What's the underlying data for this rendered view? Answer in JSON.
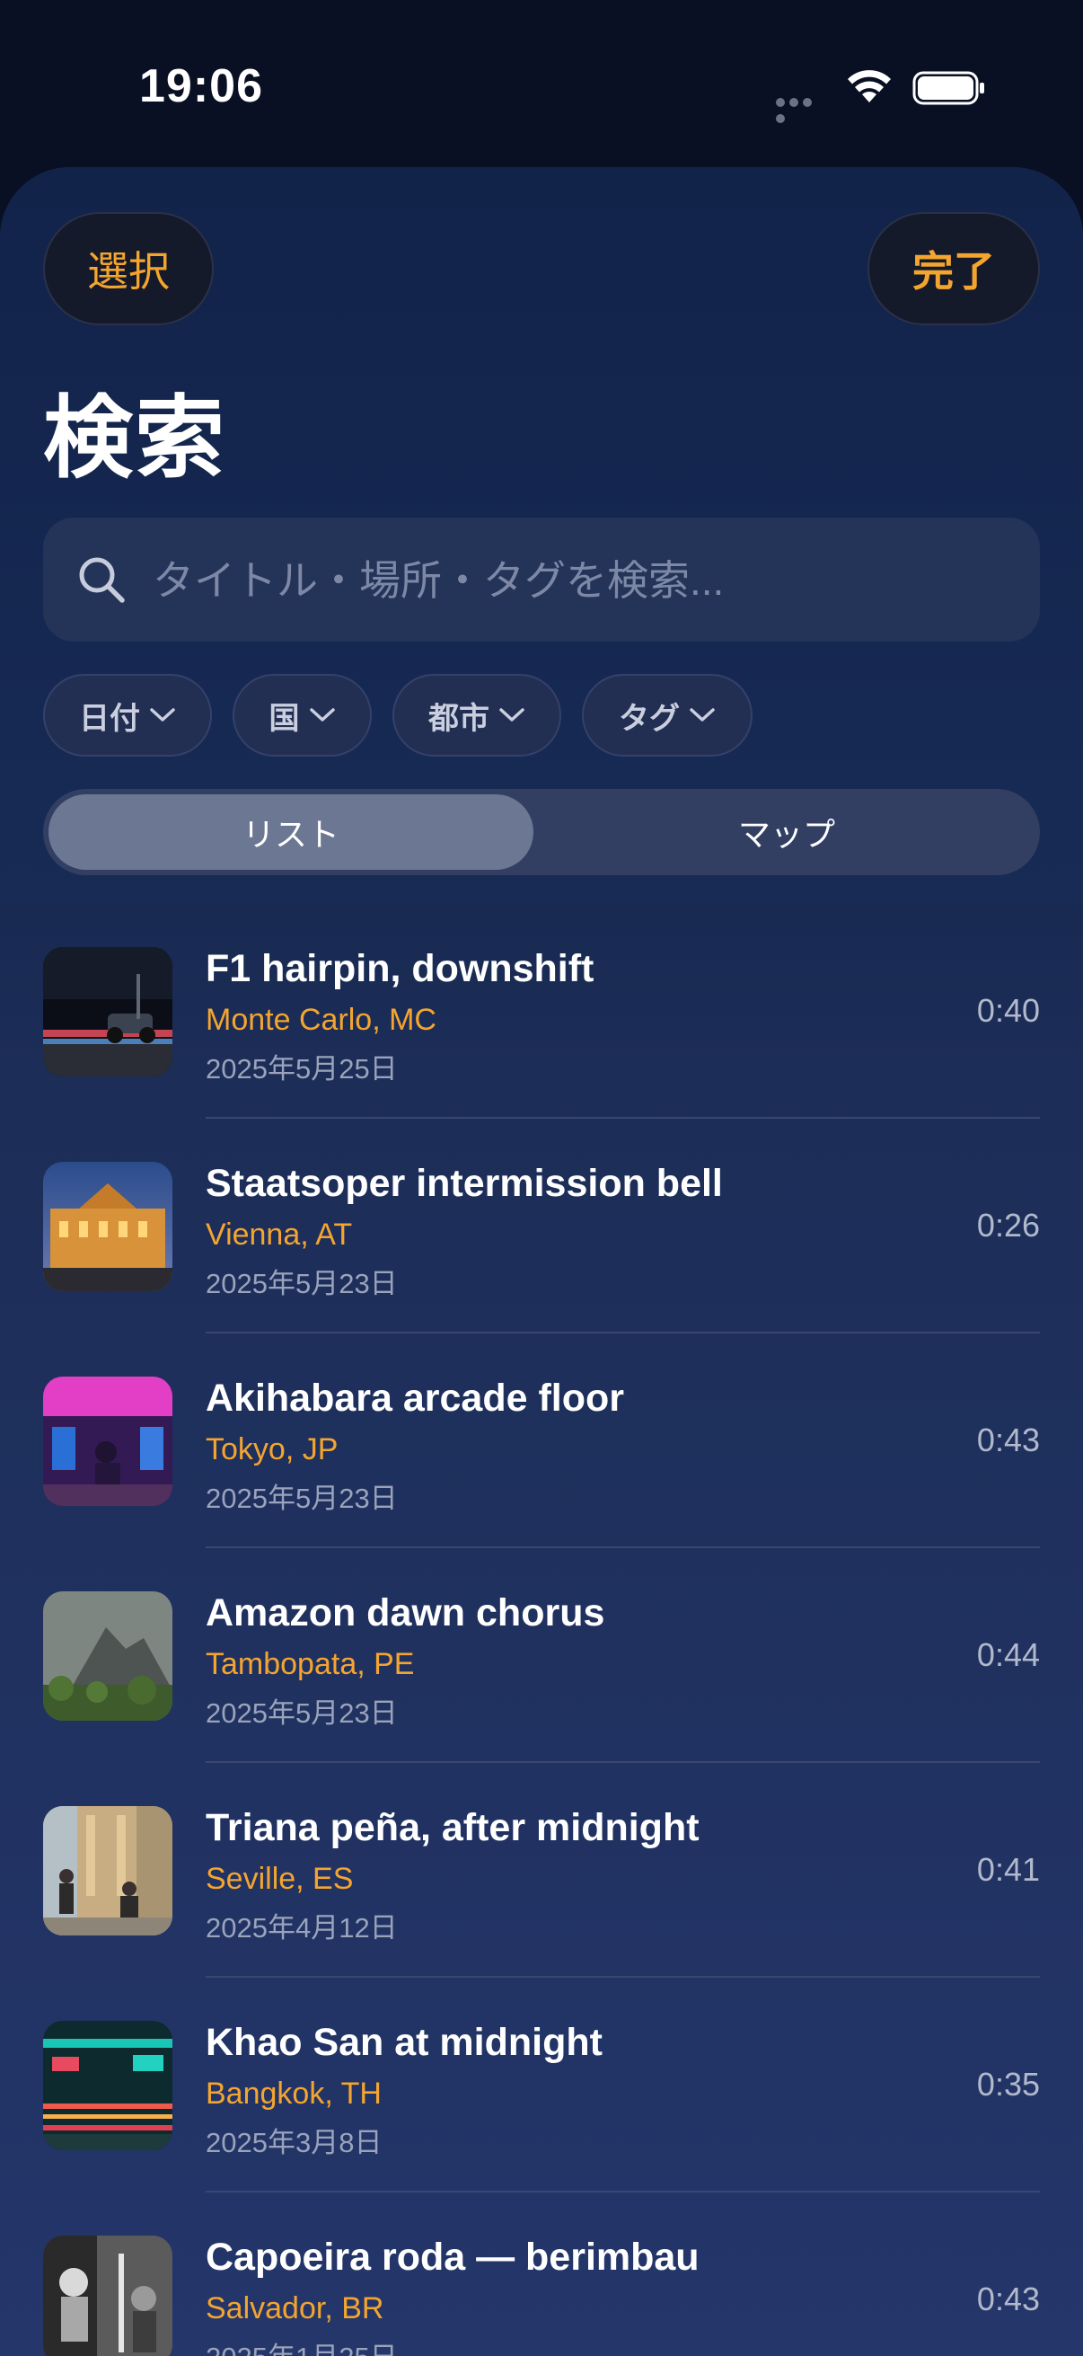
{
  "status_bar": {
    "time": "19:06"
  },
  "header": {
    "select_label": "選択",
    "done_label": "完了",
    "title": "検索"
  },
  "search": {
    "placeholder": "タイトル・場所・タグを検索..."
  },
  "filters": [
    {
      "label": "日付"
    },
    {
      "label": "国"
    },
    {
      "label": "都市"
    },
    {
      "label": "タグ"
    }
  ],
  "segment": {
    "list_label": "リスト",
    "map_label": "マップ",
    "selected": "リスト"
  },
  "recordings": [
    {
      "title": "F1 hairpin, downshift",
      "location": "Monte Carlo, MC",
      "date": "2025年5月25日",
      "duration": "0:40"
    },
    {
      "title": "Staatsoper intermission bell",
      "location": "Vienna, AT",
      "date": "2025年5月23日",
      "duration": "0:26"
    },
    {
      "title": "Akihabara arcade floor",
      "location": "Tokyo, JP",
      "date": "2025年5月23日",
      "duration": "0:43"
    },
    {
      "title": "Amazon dawn chorus",
      "location": "Tambopata, PE",
      "date": "2025年5月23日",
      "duration": "0:44"
    },
    {
      "title": "Triana peña, after midnight",
      "location": "Seville, ES",
      "date": "2025年4月12日",
      "duration": "0:41"
    },
    {
      "title": "Khao San at midnight",
      "location": "Bangkok, TH",
      "date": "2025年3月8日",
      "duration": "0:35"
    },
    {
      "title": "Capoeira roda — berimbau",
      "location": "Salvador, BR",
      "date": "2025年1月25日",
      "duration": "0:43"
    }
  ],
  "colors": {
    "accent": "#f4a52f",
    "background": "#0a1023",
    "sheet": "#172b55"
  }
}
